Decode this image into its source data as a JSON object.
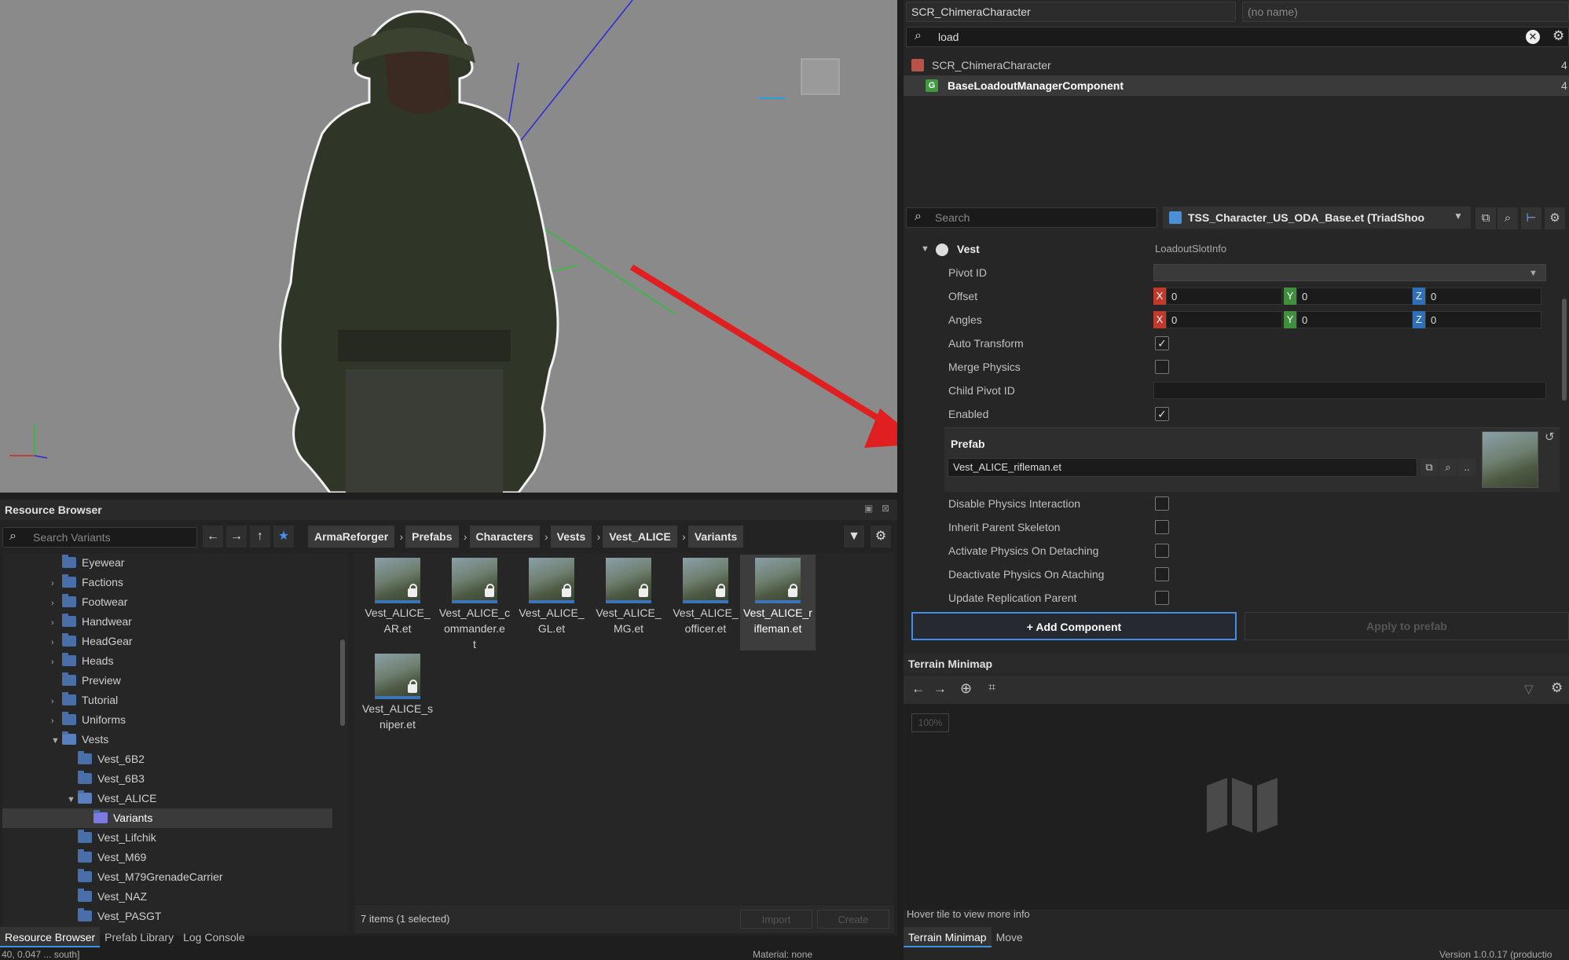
{
  "entity": {
    "class_name": "SCR_ChimeraCharacter",
    "name_placeholder": "(no name)",
    "filter_value": "load"
  },
  "components": [
    {
      "label": "SCR_ChimeraCharacter",
      "count": "4"
    },
    {
      "label": "BaseLoadoutManagerComponent",
      "count": "4"
    }
  ],
  "inspector": {
    "search_placeholder": "Search",
    "prefab_file": "TSS_Character_US_ODA_Base.et (TriadShoo",
    "section": {
      "label": "Vest",
      "type": "LoadoutSlotInfo"
    },
    "labels": {
      "pivot_id": "Pivot ID",
      "offset": "Offset",
      "angles": "Angles",
      "auto_transform": "Auto Transform",
      "merge_physics": "Merge Physics",
      "child_pivot_id": "Child Pivot ID",
      "enabled": "Enabled",
      "prefab": "Prefab",
      "disable_physics": "Disable Physics Interaction",
      "inherit_skeleton": "Inherit Parent Skeleton",
      "activate_physics": "Activate Physics On Detaching",
      "deactivate_physics": "Deactivate Physics On Ataching",
      "update_replication": "Update Replication Parent"
    },
    "axes": {
      "x": "X",
      "y": "Y",
      "z": "Z"
    },
    "offset": {
      "x": "0",
      "y": "0",
      "z": "0"
    },
    "angles": {
      "x": "0",
      "y": "0",
      "z": "0"
    },
    "checks": {
      "auto_transform": true,
      "merge_physics": false,
      "enabled": true,
      "disable_physics": false,
      "inherit_skeleton": false,
      "activate_physics": false,
      "deactivate_physics": false,
      "update_replication": false
    },
    "prefab_value": "Vest_ALICE_rifleman.et",
    "dots_label": "..",
    "add_component": "+ Add Component",
    "apply_prefab": "Apply to prefab"
  },
  "minimap": {
    "title": "Terrain Minimap",
    "zoom": "100%",
    "hint": "Hover tile to view more info"
  },
  "resource_browser": {
    "title": "Resource Browser",
    "search_placeholder": "Search Variants",
    "breadcrumbs": [
      "ArmaReforger",
      "Prefabs",
      "Characters",
      "Vests",
      "Vest_ALICE",
      "Variants"
    ],
    "tree": [
      "Eyewear",
      "Factions",
      "Footwear",
      "Handwear",
      "HeadGear",
      "Heads",
      "Preview",
      "Tutorial",
      "Uniforms",
      "Vests",
      "Vest_6B2",
      "Vest_6B3",
      "Vest_ALICE",
      "Variants",
      "Vest_Lifchik",
      "Vest_M69",
      "Vest_M79GrenadeCarrier",
      "Vest_NAZ",
      "Vest_PASGT"
    ],
    "files": [
      "Vest_ALICE_\nAR.et",
      "Vest_ALICE_c\nommander.e\nt",
      "Vest_ALICE_\nGL.et",
      "Vest_ALICE_\nMG.et",
      "Vest_ALICE_\nofficer.et",
      "Vest_ALICE_r\nifleman.et",
      "Vest_ALICE_s\nniper.et"
    ],
    "status": "7 items (1 selected)",
    "import": "Import",
    "create": "Create"
  },
  "bottom_tabs_left": [
    "Resource Browser",
    "Prefab Library",
    "Log Console"
  ],
  "bottom_tabs_right": [
    "Terrain Minimap",
    "Move"
  ],
  "statusbar": {
    "left": "40, 0.047 ... south]",
    "mid": "Material: none",
    "right": "Version 1.0.0.17 (productio"
  },
  "colors": {
    "accent": "#3f8ee8",
    "arrow": "#e02020",
    "axis_x": "#c0392b",
    "axis_y": "#3f8f3f",
    "axis_z": "#2f6fb8"
  }
}
